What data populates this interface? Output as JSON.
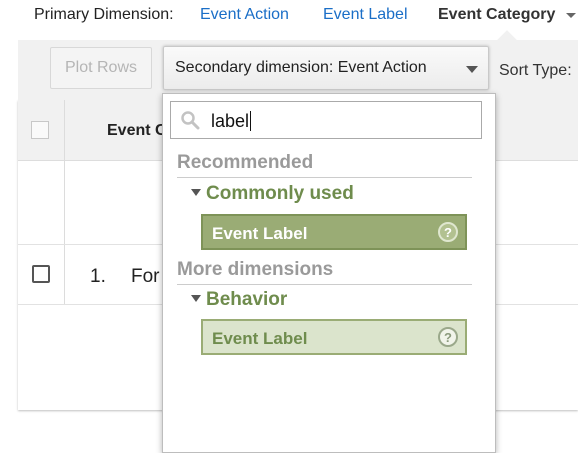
{
  "primary_dimension": {
    "label": "Primary Dimension:",
    "options": [
      "Event Action",
      "Event Label"
    ],
    "active": "Event Category"
  },
  "toolbar": {
    "plot_rows": "Plot Rows",
    "secondary_dimension": "Secondary dimension: Event Action",
    "sort_type": "Sort Type:"
  },
  "table": {
    "header": "Event C",
    "rows": [
      {
        "num": "1.",
        "text": "For"
      }
    ]
  },
  "dropdown": {
    "search_value": "label",
    "sections": [
      {
        "title": "Recommended",
        "group": "Commonly used",
        "item": "Event Label",
        "help": "?"
      },
      {
        "title": "More dimensions",
        "group": "Behavior",
        "item": "Event Label",
        "help": "?"
      }
    ]
  },
  "colors": {
    "link": "#1a6ec7",
    "accent_green": "#9aac75",
    "group_green": "#6f8c4d",
    "item_highlight_bg": "#9aac75",
    "item_bg": "#dbe4cc"
  }
}
